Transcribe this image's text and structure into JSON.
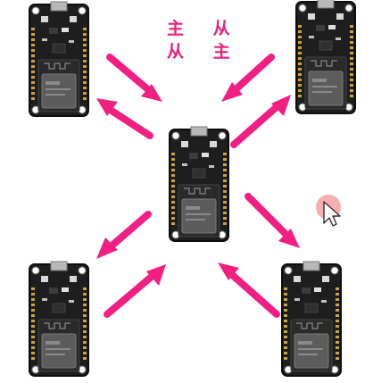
{
  "labels": {
    "line1": "主 从",
    "line2": "从 主"
  },
  "colors": {
    "arrow": "#f21f82",
    "board_pcb": "#1e1e1e",
    "board_edge": "#0d0d0d",
    "module": "#2a2a2a",
    "chip": "#5c5c5c",
    "pin": "#c9a43a"
  },
  "boards": [
    {
      "name": "esp32-board-top-left"
    },
    {
      "name": "esp32-board-top-right"
    },
    {
      "name": "esp32-board-center"
    },
    {
      "name": "esp32-board-bottom-left"
    },
    {
      "name": "esp32-board-bottom-right"
    }
  ],
  "cursor": {
    "icon": "mouse-pointer-icon",
    "highlight_color": "#f4a0a0"
  }
}
